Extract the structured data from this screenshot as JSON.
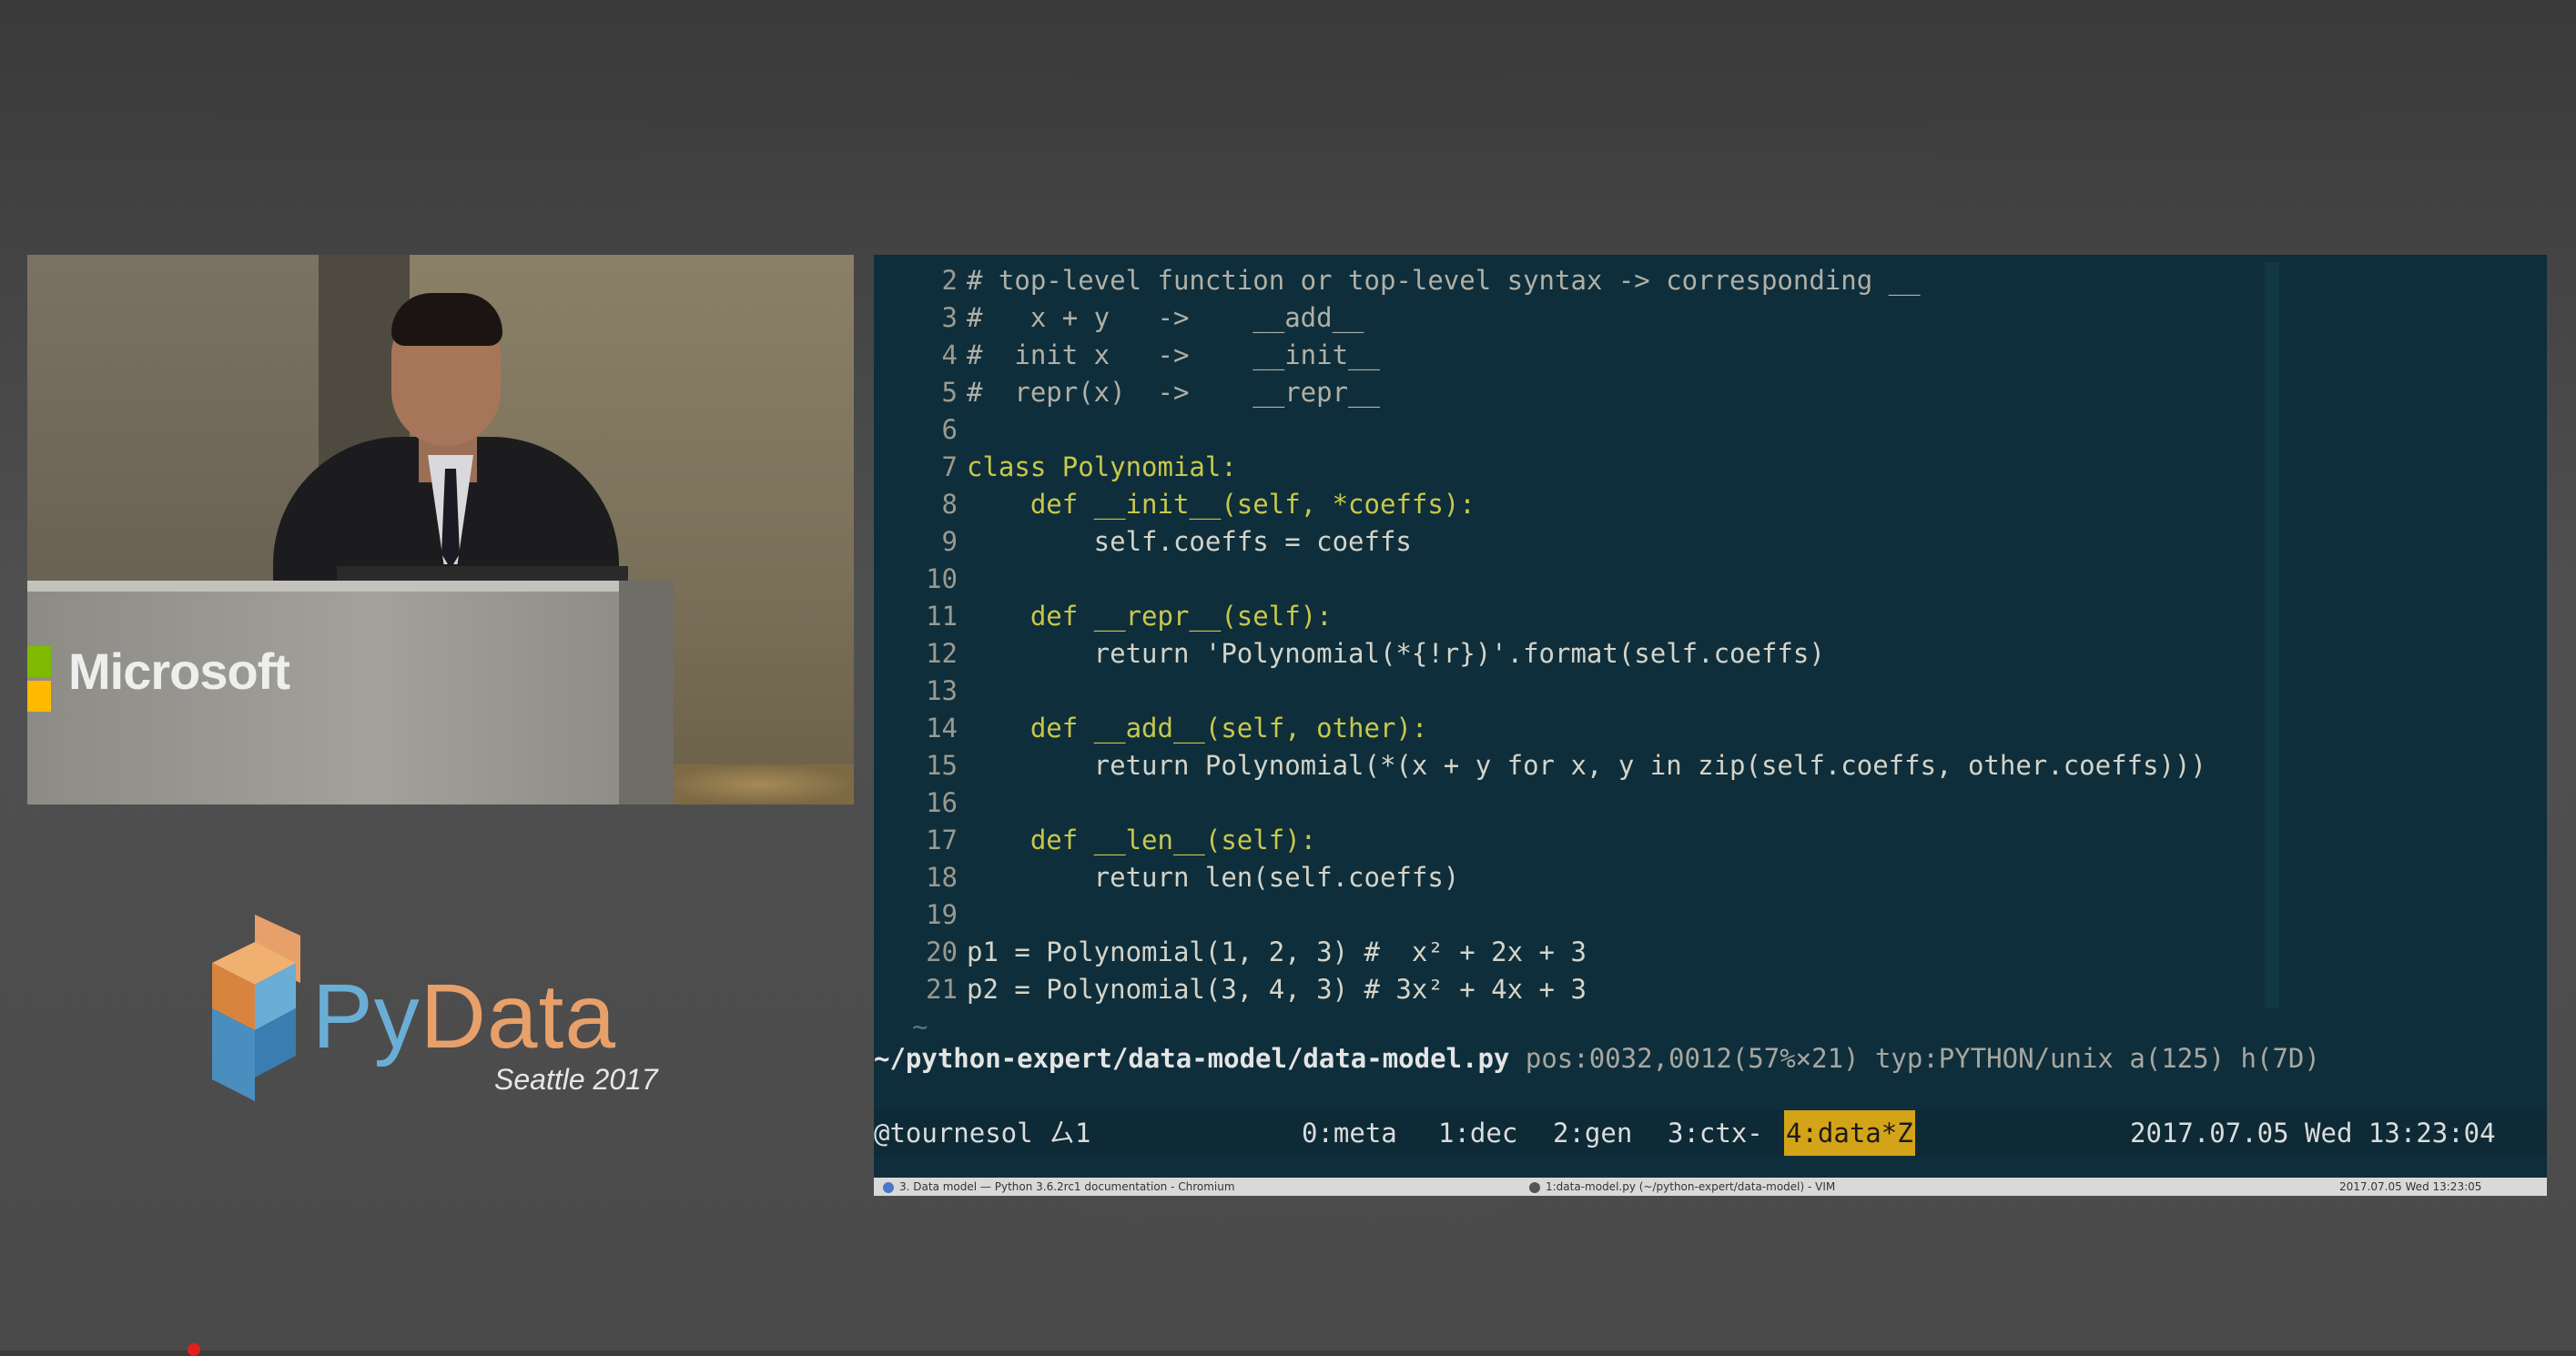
{
  "video": {
    "logo_text": "Microsoft"
  },
  "branding": {
    "py": "Py",
    "data": "Data",
    "subtitle": "Seattle 2017"
  },
  "editor": {
    "lines": [
      {
        "n": "2",
        "text": "# top-level function or top-level syntax -> corresponding __"
      },
      {
        "n": "3",
        "text": "#   x + y   ->    __add__"
      },
      {
        "n": "4",
        "text": "#  init x   ->    __init__"
      },
      {
        "n": "5",
        "text": "#  repr(x)  ->    __repr__"
      },
      {
        "n": "6",
        "text": ""
      },
      {
        "n": "7",
        "text": "class Polynomial:"
      },
      {
        "n": "8",
        "text": "    def __init__(self, *coeffs):"
      },
      {
        "n": "9",
        "text": "        self.coeffs = coeffs"
      },
      {
        "n": "10",
        "text": ""
      },
      {
        "n": "11",
        "text": "    def __repr__(self):"
      },
      {
        "n": "12",
        "text": "        return 'Polynomial(*{!r})'.format(self.coeffs)"
      },
      {
        "n": "13",
        "text": ""
      },
      {
        "n": "14",
        "text": "    def __add__(self, other):"
      },
      {
        "n": "15",
        "text": "        return Polynomial(*(x + y for x, y in zip(self.coeffs, other.coeffs)))"
      },
      {
        "n": "16",
        "text": ""
      },
      {
        "n": "17",
        "text": "    def __len__(self):"
      },
      {
        "n": "18",
        "text": "        return len(self.coeffs)"
      },
      {
        "n": "19",
        "text": ""
      },
      {
        "n": "20",
        "text": "p1 = Polynomial(1, 2, 3) #  x² + 2x + 3"
      },
      {
        "n": "21",
        "text": "p2 = Polynomial(3, 4, 3) # 3x² + 4x + 3"
      }
    ],
    "empty_marker": "~"
  },
  "statusline": {
    "path": "~/python-expert/data-model/data-model.py",
    "info": "pos:0032,0012(57%×21) typ:PYTHON/unix a(125) h(7D)"
  },
  "tmux": {
    "session": "@tournesol ㄙ1",
    "windows": [
      "0:meta",
      "1:dec",
      "2:gen",
      "3:ctx-",
      "4:data*Z"
    ],
    "datetime": "2017.07.05 Wed 13:23:04"
  },
  "taskbar": {
    "left": "3. Data model — Python 3.6.2rc1 documentation - Chromium",
    "middle": "1:data-model.py (~/python-expert/data-model) - VIM",
    "right": "2017.07.05 Wed 13:23:05"
  },
  "colors": {
    "terminal_bg": "#0f2e3b",
    "keyword": "#c8c84a",
    "class_name": "#5aa6e8",
    "tmux_active": "#d4a418",
    "pydata_blue": "#6aaed6",
    "pydata_orange": "#e8a06a"
  }
}
